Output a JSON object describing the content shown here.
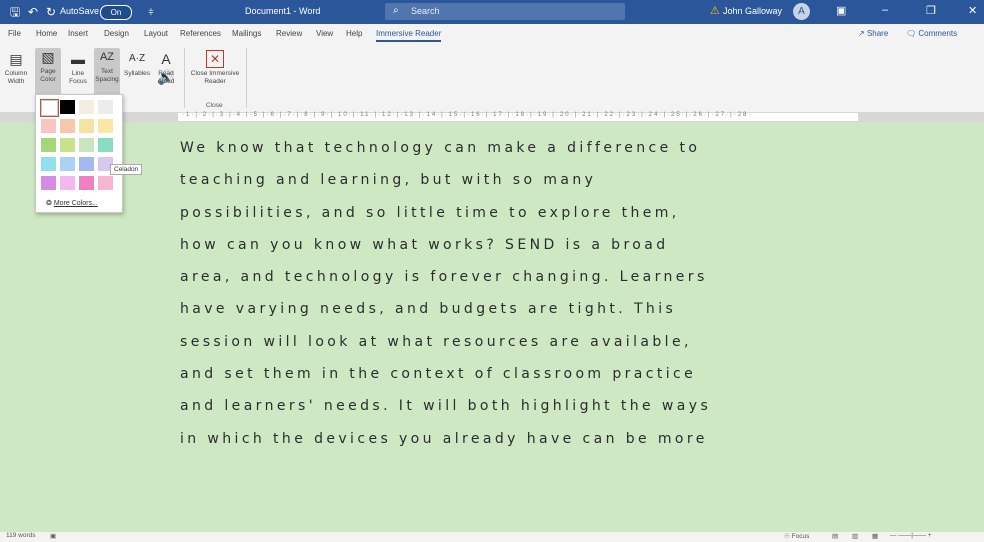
{
  "titlebar": {
    "autosave_label": "AutoSave",
    "autosave_state": "On",
    "doc_title": "Document1 - Word",
    "search_placeholder": "Search",
    "user_name": "John Galloway",
    "user_initial": "A",
    "bg_color": "#2b579a"
  },
  "tabs": [
    "File",
    "Home",
    "Insert",
    "Design",
    "Layout",
    "References",
    "Mailings",
    "Review",
    "View",
    "Help",
    "Immersive Reader"
  ],
  "share": {
    "share_label": "Share",
    "comments_label": "Comments"
  },
  "ribbon": {
    "buttons": [
      {
        "label": "Column Width",
        "icon": "column-width-icon"
      },
      {
        "label": "Page Color",
        "icon": "page-color-icon"
      },
      {
        "label": "Line Focus",
        "icon": "line-focus-icon"
      },
      {
        "label": "Text Spacing",
        "icon": "text-spacing-icon"
      },
      {
        "label": "Syllables",
        "icon": "syllables-icon"
      },
      {
        "label": "Read Aloud",
        "icon": "read-aloud-icon"
      },
      {
        "label": "Close Immersive Reader",
        "icon": "close-reader-icon"
      }
    ],
    "close_group_label": "Close"
  },
  "color_dropdown": {
    "tooltip": "Celadon",
    "more_colors": "More Colors...",
    "swatches": [
      [
        "#ffffff",
        "#000000",
        "#f5ede0",
        "#ececec"
      ],
      [
        "#f8c4c4",
        "#f7c7ab",
        "#f4e3a3",
        "#fbe7a3"
      ],
      [
        "#a6d67a",
        "#c9e08d",
        "#c7e6c0",
        "#88dcbf"
      ],
      [
        "#92e0ea",
        "#a9d3f0",
        "#a6b8f0",
        "#d6c6f0"
      ],
      [
        "#d58ae8",
        "#f3b6ee",
        "#f080c0",
        "#f7b5d4"
      ]
    ]
  },
  "page": {
    "bg_color": "#cfe8c4",
    "lines": [
      "We know that technology can make a difference to",
      "teaching and learning, but with so many",
      "possibilities, and so little time to explore them,",
      "how can you know what works? SEND is a broad",
      "area, and technology is forever changing. Learners",
      "have varying needs, and budgets are tight. This",
      "session will look at what resources are available,",
      "and set them in the context of classroom practice",
      "and learners' needs. It will both highlight the ways",
      "in which the devices you already have can be more"
    ]
  },
  "status": {
    "words": "119 words",
    "focus": "Focus"
  }
}
